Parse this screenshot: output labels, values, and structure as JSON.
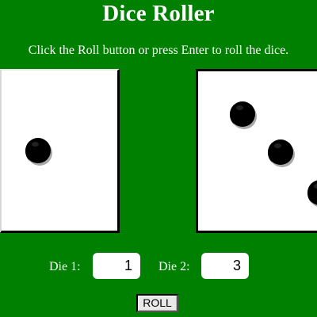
{
  "page": {
    "title": "Dice Roller",
    "instructions": "Click the Roll button or press Enter to roll the dice."
  },
  "dice": {
    "die1": {
      "label": "Die 1:",
      "value": "1"
    },
    "die2": {
      "label": "Die 2:",
      "value": "3"
    }
  },
  "controls": {
    "roll_label": "ROLL"
  },
  "colors": {
    "background": "#008000",
    "die_face": "#ffffff",
    "pip": "#000000",
    "text": "#ffffff"
  }
}
